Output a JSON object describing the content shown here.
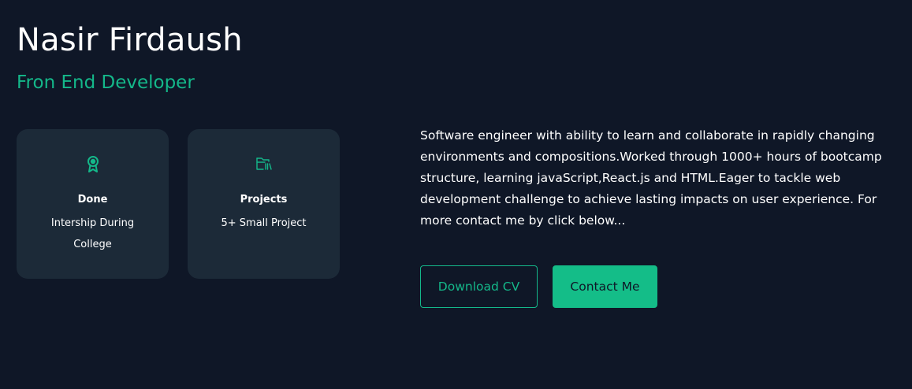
{
  "header": {
    "name": "Nasir Firdaush",
    "role": "Fron End Developer"
  },
  "cards": [
    {
      "icon": "award-icon",
      "title": "Done",
      "description": "Intership During College"
    },
    {
      "icon": "folder-icon",
      "title": "Projects",
      "description": "5+ Small Project"
    }
  ],
  "about": {
    "text": "Software engineer with ability to learn and collaborate in rapidly changing environments and compositions.Worked through 1000+ hours of bootcamp structure, learning javaScript,React.js and HTML.Eager to tackle web development challenge to achieve lasting impacts on user experience. For more contact me by click below..."
  },
  "buttons": {
    "download_label": "Download CV",
    "contact_label": "Contact Me"
  },
  "colors": {
    "background": "#0f1727",
    "card": "#1c2a38",
    "accent": "#14b88a"
  }
}
